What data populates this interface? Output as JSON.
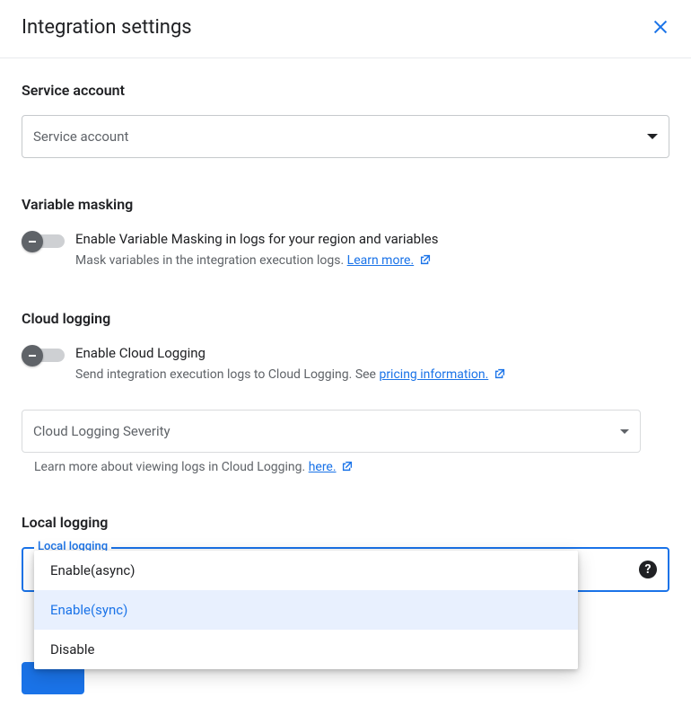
{
  "header": {
    "title": "Integration settings"
  },
  "serviceAccount": {
    "title": "Service account",
    "placeholder": "Service account"
  },
  "variableMasking": {
    "title": "Variable masking",
    "primary": "Enable Variable Masking in logs for your region and variables",
    "secondary_prefix": "Mask variables in the integration execution logs. ",
    "learn_more": "Learn more."
  },
  "cloudLogging": {
    "title": "Cloud logging",
    "primary": "Enable Cloud Logging",
    "secondary_prefix": "Send integration execution logs to Cloud Logging. See ",
    "pricing_link": "pricing information.",
    "severity_placeholder": "Cloud Logging Severity",
    "help_prefix": "Learn more about viewing logs in Cloud Logging. ",
    "help_link": "here."
  },
  "localLogging": {
    "title": "Local logging",
    "field_label": "Local logging",
    "options": [
      "Enable(async)",
      "Enable(sync)",
      "Disable"
    ],
    "selected": "Enable(sync)"
  },
  "colors": {
    "accent": "#1a73e8"
  }
}
